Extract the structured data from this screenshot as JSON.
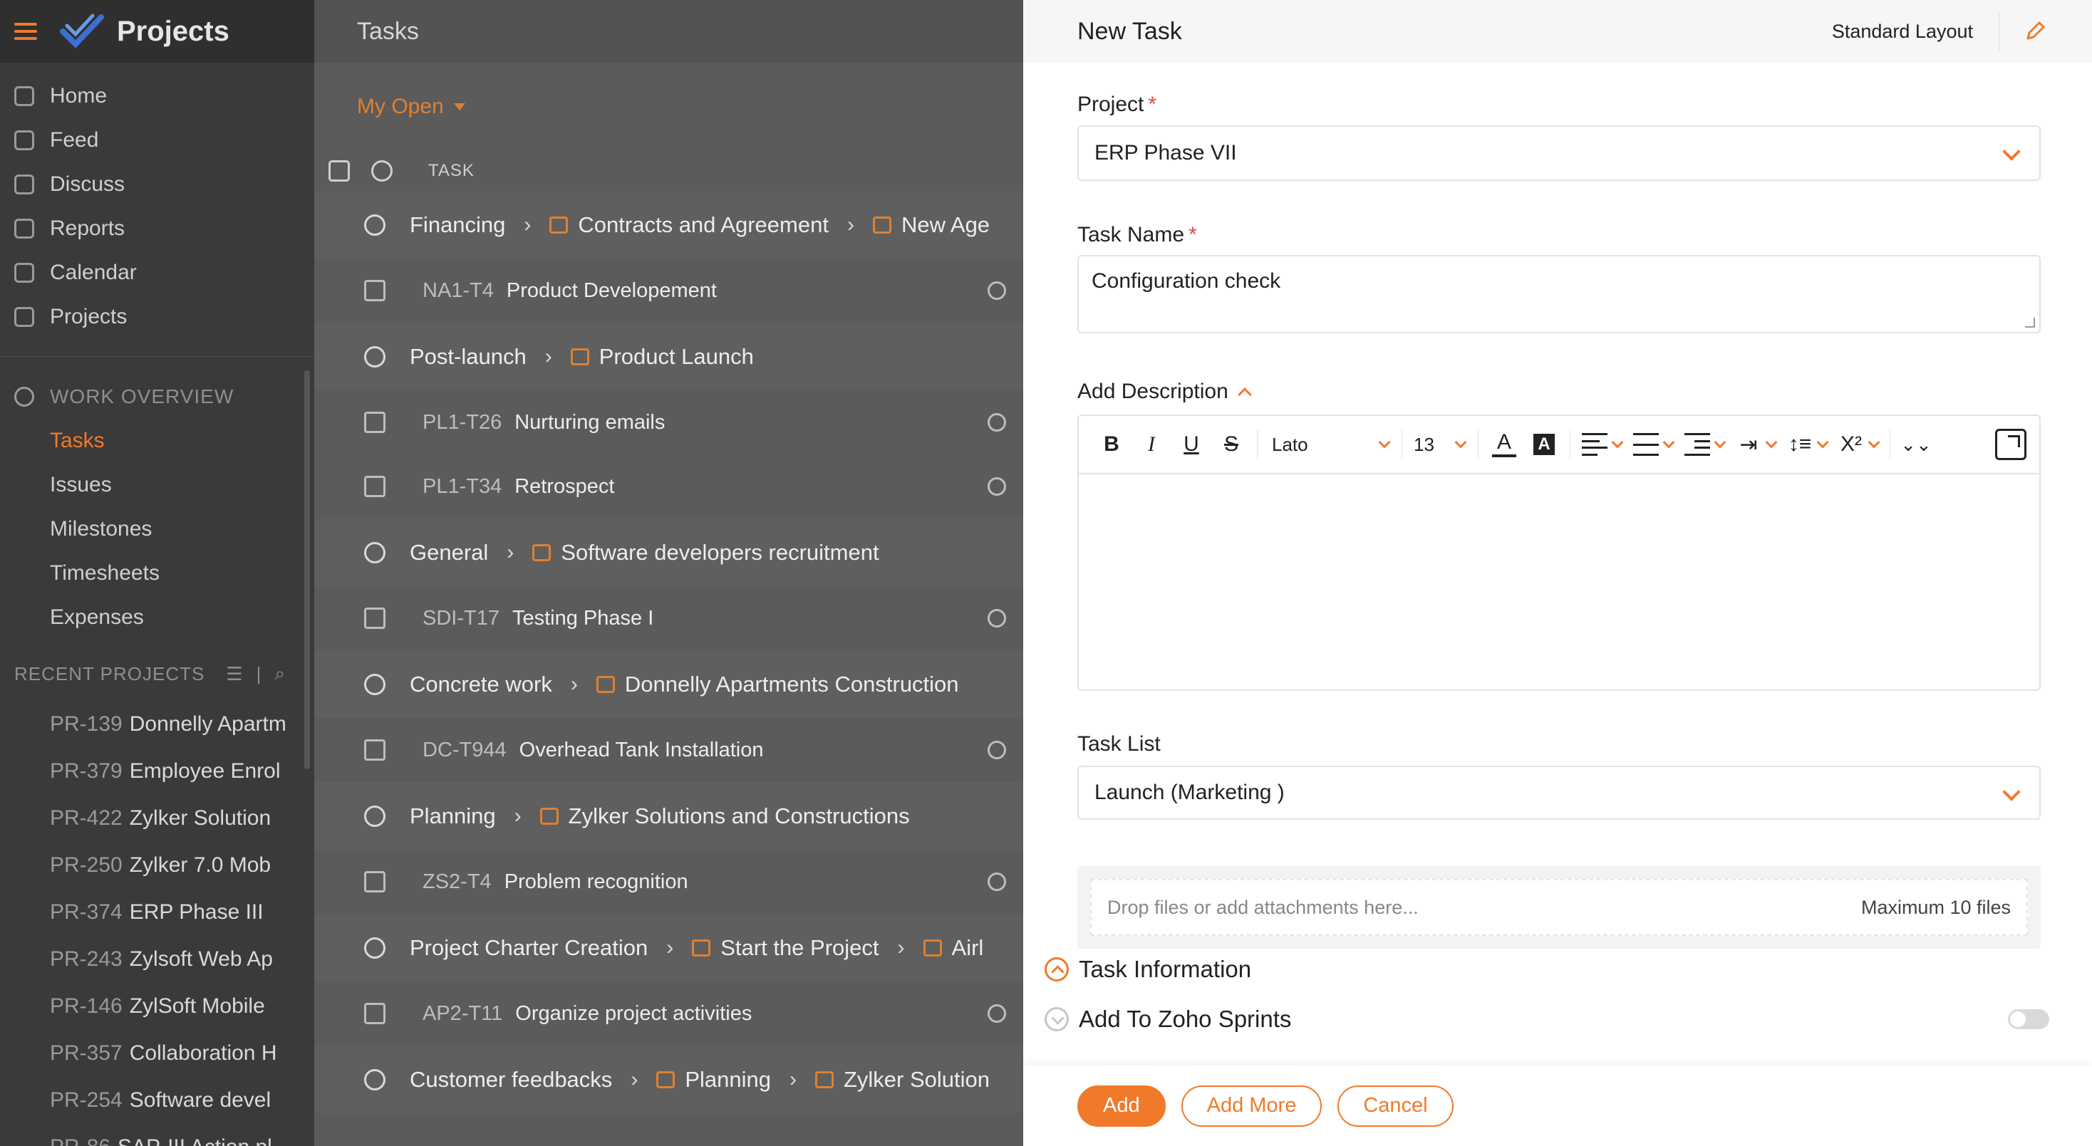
{
  "app": {
    "title": "Projects"
  },
  "sidebar": {
    "nav": [
      "Home",
      "Feed",
      "Discuss",
      "Reports",
      "Calendar",
      "Projects"
    ],
    "work_overview": {
      "title": "WORK OVERVIEW",
      "items": [
        "Tasks",
        "Issues",
        "Milestones",
        "Timesheets",
        "Expenses"
      ],
      "active": "Tasks"
    },
    "recent": {
      "title": "RECENT PROJECTS",
      "projects": [
        {
          "id": "PR-139",
          "name": "Donnelly Apartm"
        },
        {
          "id": "PR-379",
          "name": "Employee Enrol"
        },
        {
          "id": "PR-422",
          "name": "Zylker Solution"
        },
        {
          "id": "PR-250",
          "name": "Zylker 7.0 Mob"
        },
        {
          "id": "PR-374",
          "name": "ERP Phase III"
        },
        {
          "id": "PR-243",
          "name": "Zylsoft Web Ap"
        },
        {
          "id": "PR-146",
          "name": "ZylSoft Mobile"
        },
        {
          "id": "PR-357",
          "name": "Collaboration H"
        },
        {
          "id": "PR-254",
          "name": "Software devel"
        },
        {
          "id": "PR-86",
          "name": "SAP-III Action pl"
        }
      ]
    }
  },
  "tasks": {
    "header": "Tasks",
    "filter": "My Open",
    "column": "TASK",
    "groups": [
      {
        "path": [
          "Financing",
          "Contracts and Agreement",
          "New Age"
        ],
        "rows": [
          {
            "id": "NA1-T4",
            "name": "Product Developement"
          }
        ]
      },
      {
        "path": [
          "Post-launch",
          "Product Launch"
        ],
        "rows": [
          {
            "id": "PL1-T26",
            "name": "Nurturing emails"
          },
          {
            "id": "PL1-T34",
            "name": "Retrospect"
          }
        ]
      },
      {
        "path": [
          "General",
          "Software developers recruitment"
        ],
        "rows": [
          {
            "id": "SDI-T17",
            "name": "Testing Phase I"
          }
        ]
      },
      {
        "path": [
          "Concrete work",
          "Donnelly Apartments Construction"
        ],
        "rows": [
          {
            "id": "DC-T944",
            "name": "Overhead Tank Installation"
          }
        ]
      },
      {
        "path": [
          "Planning",
          "Zylker Solutions and Constructions"
        ],
        "rows": [
          {
            "id": "ZS2-T4",
            "name": "Problem recognition"
          }
        ]
      },
      {
        "path": [
          "Project Charter Creation",
          "Start the Project",
          "Airl"
        ],
        "rows": [
          {
            "id": "AP2-T11",
            "name": "Organize project activities"
          }
        ]
      },
      {
        "path": [
          "Customer feedbacks",
          "Planning",
          "Zylker Solution"
        ],
        "rows": []
      }
    ]
  },
  "panel": {
    "title": "New Task",
    "layout": "Standard Layout",
    "project": {
      "label": "Project",
      "value": "ERP Phase VII"
    },
    "task_name": {
      "label": "Task Name",
      "value": "Configuration check"
    },
    "description": {
      "label": "Add Description"
    },
    "editor": {
      "font": "Lato",
      "size": "13",
      "superscript": "X²",
      "bold": "B",
      "italic": "I",
      "underline": "U",
      "strike": "S",
      "font_color": "A",
      "highlight": "A"
    },
    "task_list": {
      "label": "Task List",
      "value": "Launch (Marketing )"
    },
    "attachments": {
      "placeholder": "Drop files or add attachments here...",
      "max": "Maximum 10 files"
    },
    "sections": {
      "info": "Task Information",
      "sprints": "Add To Zoho Sprints"
    },
    "buttons": {
      "add": "Add",
      "add_more": "Add More",
      "cancel": "Cancel"
    }
  },
  "colors": {
    "accent": "#f07a2a",
    "required": "#e5483a"
  }
}
